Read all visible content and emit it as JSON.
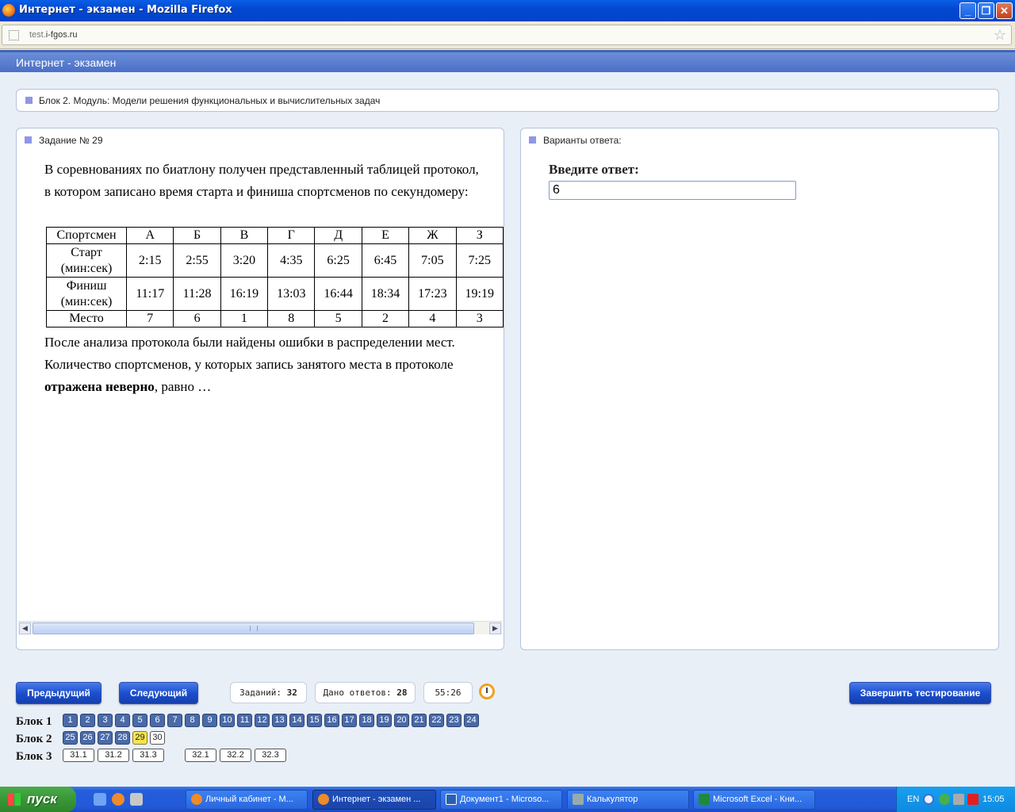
{
  "window": {
    "title": "Интернет - экзамен - Mozilla Firefox",
    "min": "_",
    "max": "❐",
    "close": "✕"
  },
  "browser": {
    "url_dim": "test.",
    "url_main": "i-fgos.ru"
  },
  "app": {
    "name": "Интернет - экзамен"
  },
  "block_bar": {
    "text": "Блок 2. Модуль: Модели решения функциональных и вычислительных задач"
  },
  "task": {
    "title": "Задание № 29",
    "intro": "В соревнованиях по биатлону получен представленный таблицей протокол, в котором записано время старта и финиша спортсменов по секундомеру:",
    "table": {
      "row_labels": [
        "Спортсмен",
        "Старт (мин:сек)",
        "Финиш (мин:сек)",
        "Место"
      ],
      "athletes": [
        "А",
        "Б",
        "В",
        "Г",
        "Д",
        "Е",
        "Ж",
        "З"
      ],
      "start": [
        "2:15",
        "2:55",
        "3:20",
        "4:35",
        "6:25",
        "6:45",
        "7:05",
        "7:25"
      ],
      "finish": [
        "11:17",
        "11:28",
        "16:19",
        "13:03",
        "16:44",
        "18:34",
        "17:23",
        "19:19"
      ],
      "place": [
        "7",
        "6",
        "1",
        "8",
        "5",
        "2",
        "4",
        "3"
      ]
    },
    "after_plain": "После анализа протокола были найдены ошибки в распределении мест. Количество спортсменов, у которых запись занятого места в протоколе ",
    "after_bold": "отражена неверно",
    "after_end": ", равно …"
  },
  "answers": {
    "title": "Варианты ответа:",
    "label": "Введите ответ:",
    "value": "6"
  },
  "nav": {
    "prev": "Предыдущий",
    "next": "Следующий",
    "tasks_label": "Заданий: ",
    "tasks_count": "32",
    "answered_label": "Дано ответов: ",
    "answered_count": "28",
    "timer": "55:26",
    "finish": "Завершить тестирование"
  },
  "blocks": {
    "b1_label": "Блок 1",
    "b2_label": "Блок 2",
    "b3_label": "Блок 3",
    "b1": [
      "1",
      "2",
      "3",
      "4",
      "5",
      "6",
      "7",
      "8",
      "9",
      "10",
      "11",
      "12",
      "13",
      "14",
      "15",
      "16",
      "17",
      "18",
      "19",
      "20",
      "21",
      "22",
      "23",
      "24"
    ],
    "b2": [
      "25",
      "26",
      "27",
      "28",
      "29",
      "30"
    ],
    "b3": [
      "31.1",
      "31.2",
      "31.3",
      "32.1",
      "32.2",
      "32.3"
    ]
  },
  "taskbar": {
    "start": "пуск",
    "items": [
      "Личный кабинет - М...",
      "Интернет - экзамен ...",
      "Документ1 - Microso...",
      "Калькулятор",
      "Microsoft Excel - Кни..."
    ],
    "lang": "EN",
    "time": "15:05"
  },
  "colors": {
    "accent": "#1c4fcf",
    "current_task": "#f4e450",
    "answered_task": "#4a6aa8"
  }
}
